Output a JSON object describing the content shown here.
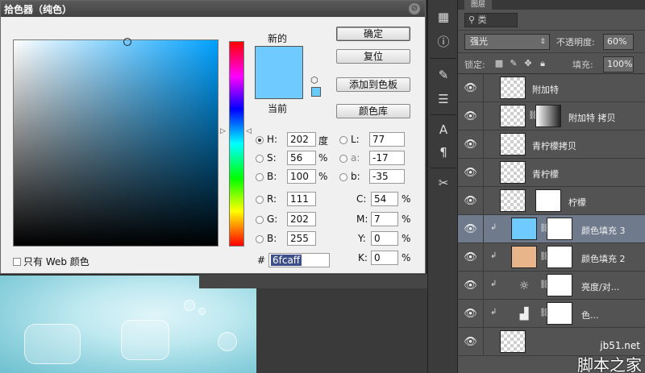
{
  "picker": {
    "title": "拾色器（纯色）",
    "new_label": "新的",
    "current_label": "当前",
    "new_color": "#6fcaff",
    "buttons": {
      "ok": "确定",
      "reset": "复位",
      "add_swatch": "添加到色板",
      "color_library": "颜色库"
    },
    "fields": {
      "h_label": "H:",
      "h_value": "202",
      "h_unit": "度",
      "s_label": "S:",
      "s_value": "56",
      "s_unit": "%",
      "b_label": "B:",
      "b_value": "100",
      "b_unit": "%",
      "r_label": "R:",
      "r_value": "111",
      "g_label": "G:",
      "g_value": "202",
      "b2_label": "B:",
      "b2_value": "255",
      "l_label": "L:",
      "l_value": "77",
      "a_label": "a:",
      "a_value": "-17",
      "lb_label": "b:",
      "lb_value": "-35",
      "c_label": "C:",
      "c_value": "54",
      "c_unit": "%",
      "m_label": "M:",
      "m_value": "7",
      "m_unit": "%",
      "y_label": "Y:",
      "y_value": "0",
      "y_unit": "%",
      "k_label": "K:",
      "k_value": "0",
      "k_unit": "%"
    },
    "web_only": "只有 Web 颜色",
    "hash": "#",
    "hex": "6fcaff"
  },
  "layers": {
    "tab": "图层",
    "filter": "类",
    "blend_mode": "强光",
    "opacity_label": "不透明度:",
    "opacity_value": "60%",
    "lock_label": "锁定:",
    "fill_label": "填充:",
    "fill_value": "100%",
    "items": [
      {
        "name": "附加特"
      },
      {
        "name": "附加特 拷贝"
      },
      {
        "name": "青柠檬拷贝"
      },
      {
        "name": "青柠檬"
      },
      {
        "name": "柠檬"
      },
      {
        "name": "颜色填充 3",
        "swatch": "#6fcaff"
      },
      {
        "name": "颜色填充 2",
        "swatch": "#e8b48a"
      },
      {
        "name": "亮度/对..."
      },
      {
        "name": "色..."
      }
    ]
  },
  "watermark": {
    "top": "jb51.net",
    "bottom": "脚本之家"
  }
}
